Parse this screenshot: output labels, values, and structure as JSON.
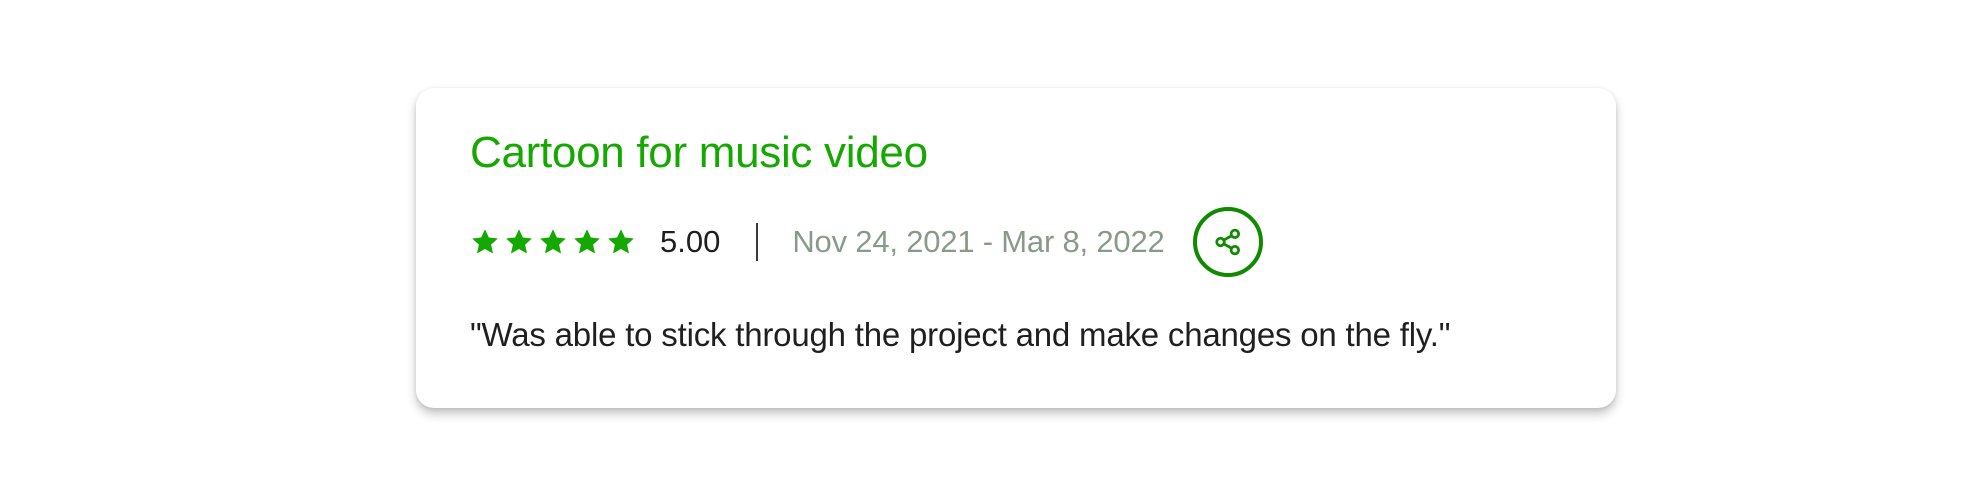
{
  "review": {
    "title": "Cartoon for music video",
    "rating_value": "5.00",
    "stars": {
      "filled": 5,
      "total": 5,
      "color": "#14a800"
    },
    "date_range": "Nov 24, 2021 - Mar 8, 2022",
    "share_icon": "share-icon",
    "quote": "\"Was able to stick through the project and make changes on the fly.\""
  },
  "colors": {
    "accent": "#14a800",
    "share_border": "#108a00",
    "date_text": "#8a9a8a",
    "body_text": "#1f1f1f"
  }
}
